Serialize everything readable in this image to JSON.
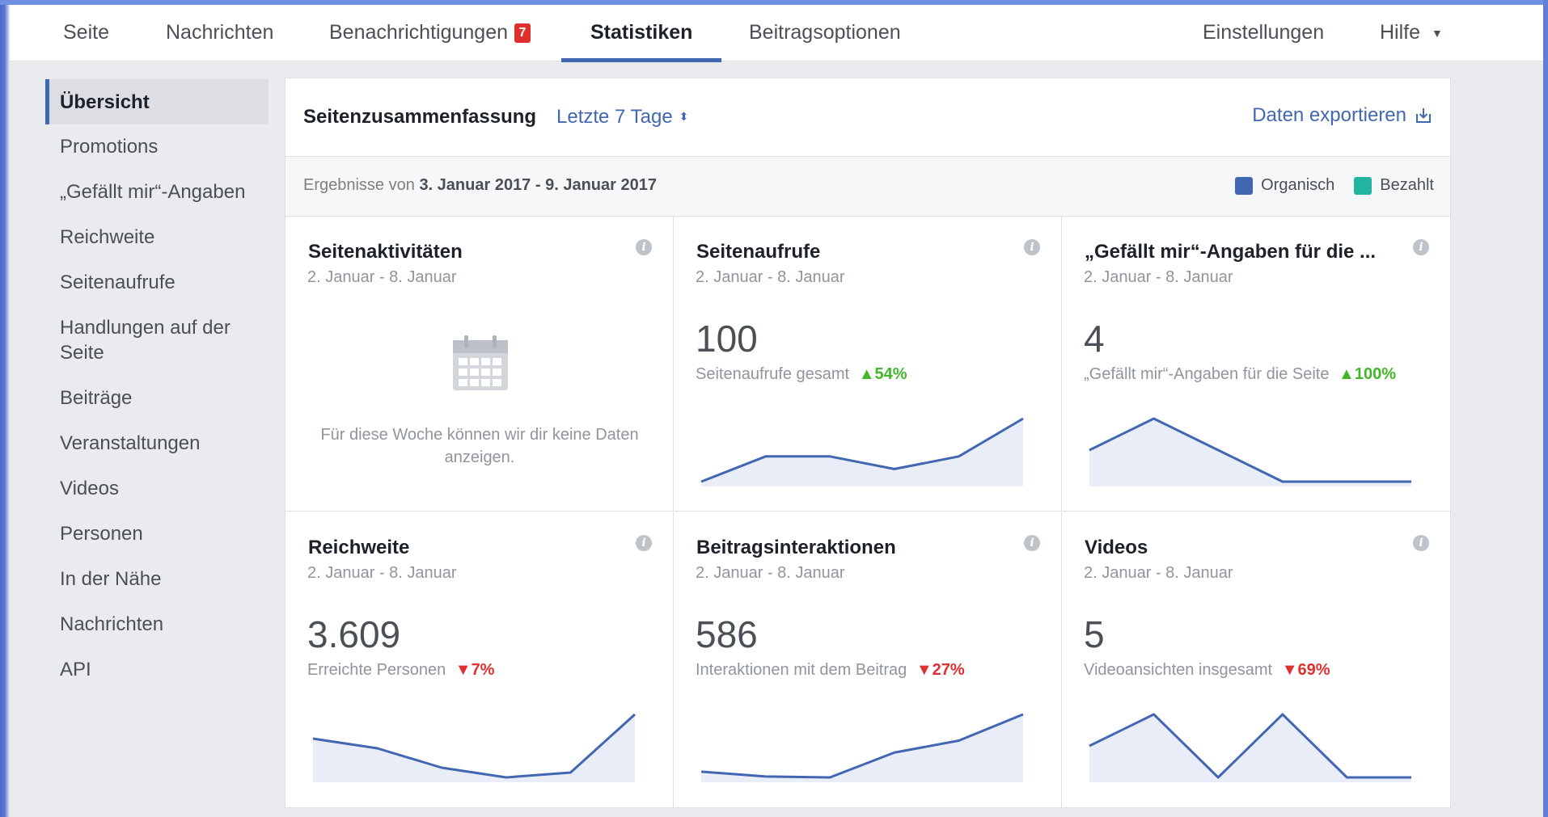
{
  "nav": {
    "tabs": [
      {
        "label": "Seite"
      },
      {
        "label": "Nachrichten"
      },
      {
        "label": "Benachrichtigungen",
        "badge": "7"
      },
      {
        "label": "Statistiken",
        "active": true
      },
      {
        "label": "Beitragsoptionen"
      }
    ],
    "right": [
      {
        "label": "Einstellungen"
      },
      {
        "label": "Hilfe"
      }
    ]
  },
  "sidebar": {
    "items": [
      {
        "label": "Übersicht",
        "active": true
      },
      {
        "label": "Promotions"
      },
      {
        "label": "„Gefällt mir“-Angaben"
      },
      {
        "label": "Reichweite"
      },
      {
        "label": "Seitenaufrufe"
      },
      {
        "label": "Handlungen auf der Seite"
      },
      {
        "label": "Beiträge"
      },
      {
        "label": "Veranstaltungen"
      },
      {
        "label": "Videos"
      },
      {
        "label": "Personen"
      },
      {
        "label": "In der Nähe"
      },
      {
        "label": "Nachrichten"
      },
      {
        "label": "API"
      }
    ]
  },
  "summary": {
    "title": "Seitenzusammenfassung",
    "range": "Letzte 7 Tage",
    "export_label": "Daten exportieren",
    "results_prefix": "Ergebnisse von",
    "results_range": "3. Januar 2017 - 9. Januar 2017",
    "legend": [
      {
        "label": "Organisch",
        "color": "#4267b2"
      },
      {
        "label": "Bezahlt",
        "color": "#21b5a0"
      }
    ]
  },
  "cards": [
    {
      "title": "Seitenaktivitäten",
      "date": "2. Januar - 8. Januar",
      "empty_message": "Für diese Woche können wir dir keine Daten anzeigen."
    },
    {
      "title": "Seitenaufrufe",
      "date": "2. Januar - 8. Januar",
      "value": "100",
      "metric": "Seitenaufrufe gesamt",
      "change": "54%",
      "direction": "up",
      "trend": [
        1,
        3,
        3,
        2,
        3,
        6
      ]
    },
    {
      "title": "„Gefällt mir“-Angaben für die ...",
      "date": "2. Januar - 8. Januar",
      "value": "4",
      "metric": "„Gefällt mir“-Angaben für die Seite",
      "change": "100%",
      "direction": "up",
      "trend": [
        1,
        2,
        1,
        0,
        0,
        0
      ]
    },
    {
      "title": "Reichweite",
      "date": "2. Januar - 8. Januar",
      "value": "3.609",
      "metric": "Erreichte Personen",
      "change": "7%",
      "direction": "down",
      "trend": [
        650,
        630,
        590,
        570,
        580,
        700
      ]
    },
    {
      "title": "Beitragsinteraktionen",
      "date": "2. Januar - 8. Januar",
      "value": "586",
      "metric": "Interaktionen mit dem Beitrag",
      "change": "27%",
      "direction": "down",
      "trend": [
        80,
        70,
        68,
        120,
        145,
        200
      ]
    },
    {
      "title": "Videos",
      "date": "2. Januar - 8. Januar",
      "value": "5",
      "metric": "Videoansichten insgesamt",
      "change": "69%",
      "direction": "down",
      "trend": [
        1,
        2,
        0,
        2,
        0,
        0
      ]
    }
  ],
  "colors": {
    "accent": "#4267b2",
    "up": "#42b72a",
    "down": "#e03030",
    "badge": "#e02d2d"
  }
}
